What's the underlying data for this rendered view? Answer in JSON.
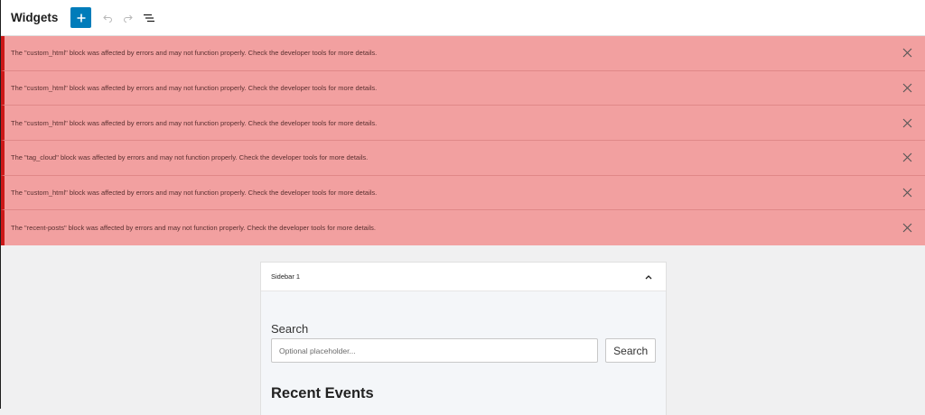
{
  "header": {
    "title": "Widgets"
  },
  "notices": [
    {
      "text": "The \"custom_html\" block was affected by errors and may not function properly. Check the developer tools for more details."
    },
    {
      "text": "The \"custom_html\" block was affected by errors and may not function properly. Check the developer tools for more details."
    },
    {
      "text": "The \"custom_html\" block was affected by errors and may not function properly. Check the developer tools for more details."
    },
    {
      "text": "The \"tag_cloud\" block was affected by errors and may not function properly. Check the developer tools for more details."
    },
    {
      "text": "The \"custom_html\" block was affected by errors and may not function properly. Check the developer tools for more details."
    },
    {
      "text": "The \"recent-posts\" block was affected by errors and may not function properly. Check the developer tools for more details."
    }
  ],
  "sidebar": {
    "title": "Sidebar 1",
    "search_label": "Search",
    "search_placeholder": "Optional placeholder...",
    "search_button": "Search",
    "recent_title": "Recent Events"
  },
  "colors": {
    "accent": "#007cba",
    "notice_bg": "#f2a0a0",
    "notice_border": "#cc1818"
  },
  "icons": {
    "add": "plus-icon",
    "undo": "undo-icon",
    "redo": "redo-icon",
    "list_view": "list-view-icon",
    "dismiss": "close-icon",
    "collapse": "chevron-up-icon"
  }
}
